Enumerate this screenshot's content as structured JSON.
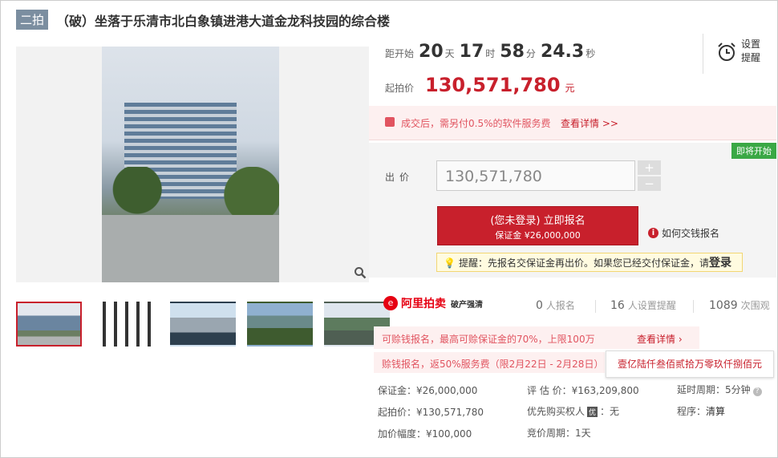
{
  "header": {
    "round": "二拍",
    "title": "（破）坐落于乐清市北白象镇进港大道金龙科技园的综合楼"
  },
  "countdown": {
    "label": "距开始",
    "days": "20",
    "days_unit": "天",
    "hours": "17",
    "hours_unit": "时",
    "minutes": "58",
    "minutes_unit": "分",
    "seconds": "24.3",
    "seconds_unit": "秒"
  },
  "reminder": {
    "line1": "设置",
    "line2": "提醒",
    "icon": "alarm-clock-icon"
  },
  "start_price": {
    "label": "起拍价",
    "value": "130,571,780",
    "unit": "元"
  },
  "fee_notice": {
    "text": "成交后，需另付0.5%的软件服务费",
    "link": "查看详情 >>"
  },
  "bid": {
    "status_badge": "即将开始",
    "label": "出价",
    "value": "130,571,780",
    "plus": "+",
    "minus": "−",
    "signup_line1": "(您未登录) 立即报名",
    "signup_line2": "保证金 ¥26,000,000",
    "howto": "如何交钱报名",
    "tip_text": "提醒：先报名交保证金再出价。如果您已经交付保证金，请",
    "tip_login": "登录"
  },
  "stats": {
    "brand": "阿里拍卖",
    "brand_sub": "破产强清",
    "signups_num": "0",
    "signups_label": "人报名",
    "reminders_num": "16",
    "reminders_label": "人设置提醒",
    "views_num": "1089",
    "views_label": "次围观"
  },
  "loan": {
    "line1": "可赊钱报名，最高可赊保证金的70%，上限100万",
    "detail": "查看详情 ›",
    "line2": "赊钱报名，返50%服务费（限2月22日 - 2月28日）",
    "tooltip": "壹亿陆仟叁佰贰拾万零玖仟捌佰元"
  },
  "info": {
    "deposit": "保证金：¥26,000,000",
    "appraisal": "评 估 价：¥163,209,800",
    "delay_label": "延时周期：",
    "delay_value": "5分钟",
    "start": "起拍价：¥130,571,780",
    "priority_label": "优先购买权人",
    "priority_badge": "优",
    "priority_value": "：无",
    "procedure_label": "程序：",
    "procedure_value": "清算",
    "increment": "加价幅度：¥100,000",
    "period": "竞价周期：1天"
  },
  "colors": {
    "accent": "#c8202c",
    "badge_green": "#3aa845",
    "notice_bg": "#fdf0f0"
  }
}
